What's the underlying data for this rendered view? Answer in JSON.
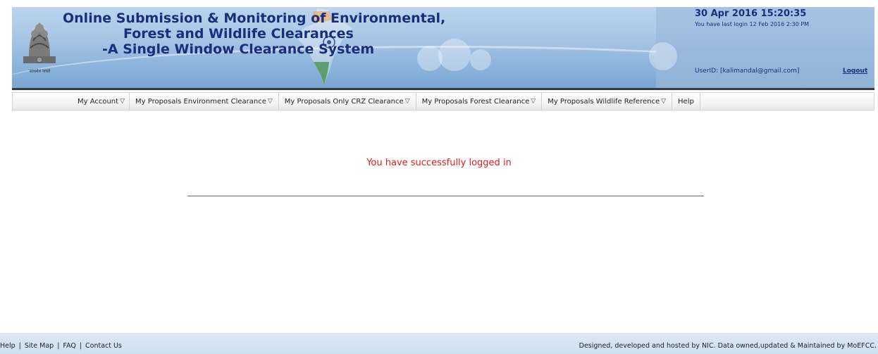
{
  "header": {
    "title_line1": "Online Submission & Monitoring of Environmental,",
    "title_line2": "Forest and Wildlife Clearances",
    "title_line3": "-A Single Window Clearance System",
    "emblem_caption": "सत्यमेव जयते",
    "datetime": "30 Apr 2016   15:20:35",
    "last_login": "You have last login 12 Feb 2016 2:30 PM",
    "user_id": "UserID: [kalimandal@gmail.com]",
    "logout_label": "Logout"
  },
  "nav": {
    "items": [
      {
        "label": "My Account",
        "arrow": "▽"
      },
      {
        "label": "My Proposals Environment Clearance",
        "arrow": "▽"
      },
      {
        "label": "My Proposals Only CRZ Clearance",
        "arrow": "▽"
      },
      {
        "label": "My Proposals Forest Clearance",
        "arrow": "▽"
      },
      {
        "label": "My Proposals Wildlife Reference",
        "arrow": "▽"
      },
      {
        "label": "Help",
        "arrow": ""
      }
    ]
  },
  "main": {
    "message": "You have successfully logged in"
  },
  "footer": {
    "links": [
      "Help",
      "Site Map",
      "FAQ",
      "Contact Us"
    ],
    "separator": "|",
    "credit": "Designed, developed and hosted by NIC. Data owned,updated & Maintained by MoEFCC."
  },
  "colors": {
    "title": "#1a2f7c",
    "message": "#e01b1b",
    "footer_bg": "#d6e4f2"
  }
}
